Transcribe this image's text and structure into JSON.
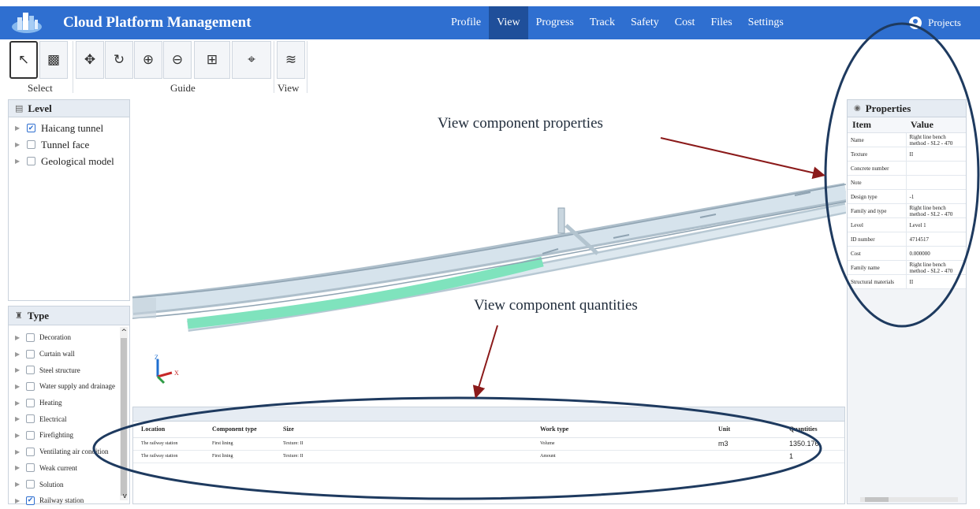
{
  "app": {
    "title": "Cloud Platform Management",
    "brand_color": "#2f6fd0",
    "logo_icon": "building-blocks-icon"
  },
  "nav": {
    "items": [
      {
        "label": "Profile"
      },
      {
        "label": "View",
        "active": true
      },
      {
        "label": "Progress"
      },
      {
        "label": "Track"
      },
      {
        "label": "Safety"
      },
      {
        "label": "Cost"
      },
      {
        "label": "Files"
      },
      {
        "label": "Settings"
      }
    ],
    "projects_label": "Projects"
  },
  "toolbar": {
    "select_label": "Select",
    "guide_label": "Guide",
    "view_label": "View",
    "tools": [
      {
        "name": "pointer-icon",
        "glyph": "↖"
      },
      {
        "name": "checkerboard-icon",
        "glyph": "▩"
      },
      {
        "name": "orbit-icon",
        "glyph": "✥"
      },
      {
        "name": "rotate-icon",
        "glyph": "↻"
      },
      {
        "name": "zoom-in-icon",
        "glyph": "⊕"
      },
      {
        "name": "zoom-out-icon",
        "glyph": "⊖"
      },
      {
        "name": "fit-icon",
        "glyph": "⊞"
      },
      {
        "name": "focus-icon",
        "glyph": "⌖"
      },
      {
        "name": "layers-icon",
        "glyph": "≋"
      }
    ]
  },
  "level_panel": {
    "title": "Level",
    "items": [
      {
        "label": "Haicang tunnel",
        "checked": true
      },
      {
        "label": "Tunnel face",
        "checked": false
      },
      {
        "label": "Geological model",
        "checked": false
      }
    ]
  },
  "type_panel": {
    "title": "Type",
    "items": [
      {
        "label": "Decoration",
        "checked": false
      },
      {
        "label": "Curtain wall",
        "checked": false
      },
      {
        "label": "Steel structure",
        "checked": false
      },
      {
        "label": "Water supply and drainage",
        "checked": false
      },
      {
        "label": "Heating",
        "checked": false
      },
      {
        "label": "Electrical",
        "checked": false
      },
      {
        "label": "Firefighting",
        "checked": false
      },
      {
        "label": "Ventilating air condition",
        "checked": false
      },
      {
        "label": "Weak current",
        "checked": false
      },
      {
        "label": "Solution",
        "checked": false
      },
      {
        "label": "Railway station",
        "checked": true
      }
    ]
  },
  "properties": {
    "title": "Properties",
    "col_item": "Item",
    "col_value": "Value",
    "rows": [
      {
        "item": "Name",
        "value": "Right line bench method - SL2 - 470"
      },
      {
        "item": "Texture",
        "value": "II"
      },
      {
        "item": "Concrete number",
        "value": ""
      },
      {
        "item": "Note",
        "value": ""
      },
      {
        "item": "Design type",
        "value": "-1"
      },
      {
        "item": "Family and type",
        "value": "Right line bench method - SL2 - 470"
      },
      {
        "item": "Level",
        "value": "Level 1"
      },
      {
        "item": "ID number",
        "value": "4714517"
      },
      {
        "item": "Cost",
        "value": "0.000000"
      },
      {
        "item": "Family name",
        "value": "Right line bench method - SL2 - 470"
      },
      {
        "item": "Structural materials",
        "value": "II"
      }
    ]
  },
  "quantities": {
    "headers": {
      "location": "Location",
      "component_type": "Component type",
      "size": "Size",
      "work_type": "Work type",
      "unit": "Unit",
      "quantities": "Quantities"
    },
    "rows": [
      {
        "location": "The railway station",
        "component_type": "First lining",
        "size": "Texture: II",
        "work_type": "Volume",
        "unit": "m3",
        "quantities": "1350.176"
      },
      {
        "location": "The railway station",
        "component_type": "First lining",
        "size": "Texture: II",
        "work_type": "Amount",
        "unit": "",
        "quantities": "1"
      }
    ]
  },
  "annotations": {
    "properties_label": "View component properties",
    "quantities_label": "View component quantities",
    "arrow_color": "#8b1a1a",
    "ellipse_color": "#1e3a5f"
  },
  "viewport": {
    "tunnel_color": "#c9d9e3",
    "highlight_color": "#7fe3bd",
    "axis_z": "Z",
    "axis_x": "X"
  }
}
